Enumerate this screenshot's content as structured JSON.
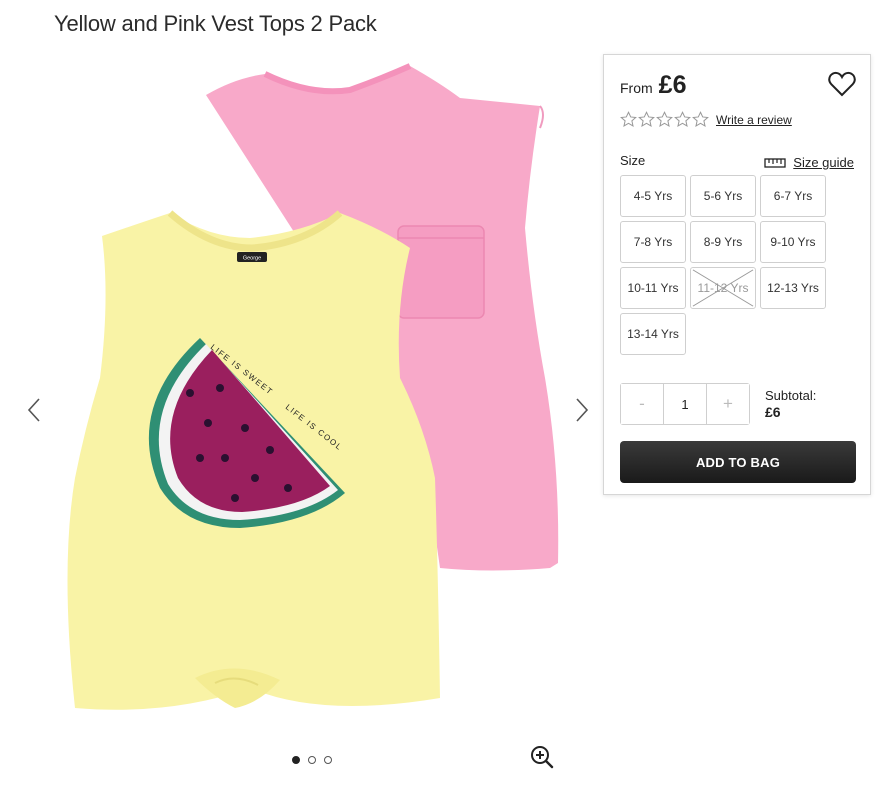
{
  "product": {
    "title": "Yellow and Pink Vest Tops 2 Pack"
  },
  "gallery": {
    "dot_count": 3,
    "active_dot": 0,
    "shirt_front_label": "George",
    "print_text_1": "LIFE IS SWEET",
    "print_text_2": "LIFE IS COOL",
    "icons": {
      "prev": "chevron-left-icon",
      "next": "chevron-right-icon",
      "zoom": "zoom-in-icon"
    }
  },
  "panel": {
    "price_prefix": "From",
    "price": "£6",
    "rating_stars": 0,
    "write_review": "Write a review",
    "size_label": "Size",
    "size_guide": "Size guide",
    "sizes": [
      {
        "label": "4-5 Yrs",
        "available": true
      },
      {
        "label": "5-6 Yrs",
        "available": true
      },
      {
        "label": "6-7 Yrs",
        "available": true
      },
      {
        "label": "7-8 Yrs",
        "available": true
      },
      {
        "label": "8-9 Yrs",
        "available": true
      },
      {
        "label": "9-10 Yrs",
        "available": true
      },
      {
        "label": "10-11 Yrs",
        "available": true
      },
      {
        "label": "11-12 Yrs",
        "available": false
      },
      {
        "label": "12-13 Yrs",
        "available": true
      },
      {
        "label": "13-14 Yrs",
        "available": true
      }
    ],
    "quantity": {
      "minus": "-",
      "value": "1",
      "plus": "+"
    },
    "subtotal_label": "Subtotal:",
    "subtotal_value": "£6",
    "add_to_bag": "ADD TO BAG",
    "colors": {
      "button": "#222222",
      "border": "#d6d6d6"
    }
  }
}
